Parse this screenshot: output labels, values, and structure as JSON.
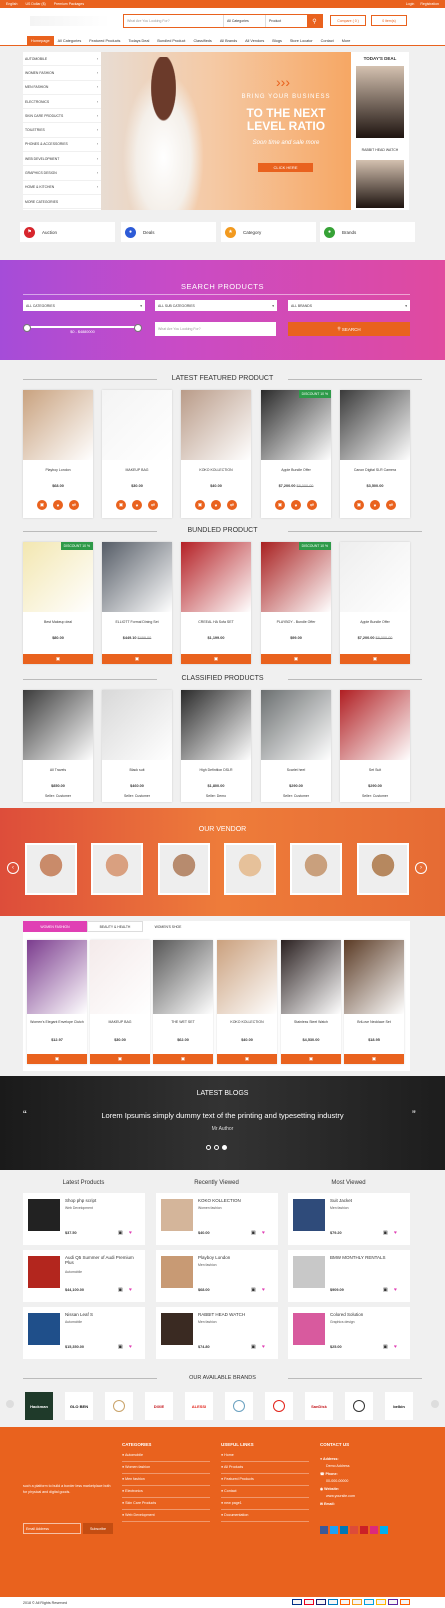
{
  "topbar": {
    "language": "English",
    "currency": "US Dollar ($)",
    "premium": "Premium Packages",
    "login": "Login",
    "register": "Registration"
  },
  "search": {
    "placeholder": "What Are You Looking For?",
    "category": "All Categories",
    "type": "Product"
  },
  "compare": "Compare ( 0 )",
  "cart": "0 item(s)",
  "nav": [
    "Homepage",
    "All Categories",
    "Featured Products",
    "Todays Deal",
    "Bundled Product",
    "Classifieds",
    "All Brands",
    "All Vendors",
    "Blogs",
    "Store Locator",
    "Contact",
    "More"
  ],
  "categories": [
    "AUTOMOBILE",
    "WOMEN FASHION",
    "MEN FASHION",
    "ELECTRONICS",
    "SKIN CARE PRODUCTS",
    "TOILETRIES",
    "PHONES & ACCESSORIES",
    "WEB DEVELOPMENT",
    "GRAPHICS DESIGN",
    "HOME & KITCHEN",
    "MORE CATEGORIES"
  ],
  "hero": {
    "line1": "BRING YOUR BUSINESS",
    "line2": "TO THE NEXT LEVEL RATIO",
    "line3": "Soon time and sale more",
    "cta": "CLICK HERE"
  },
  "todays_deal": {
    "title": "TODAY'S DEAL",
    "item": "RABBIT HEAD WATCH"
  },
  "features": [
    "Auction",
    "Deals",
    "Category",
    "Brands"
  ],
  "search_products": {
    "title": "SEARCH PRODUCTS",
    "cat": "ALL CATEGORIES",
    "subcat": "ALL SUB CATEGORIES",
    "brand": "ALL BRANDS",
    "range": "$0 - $4880000",
    "placeholder": "What Are You Looking For?",
    "button": "SEARCH"
  },
  "featured": {
    "title": "LATEST FEATURED PRODUCT",
    "items": [
      {
        "name": "Playboy London",
        "price": "$68.00",
        "old": ""
      },
      {
        "name": "MAKEUP BAG",
        "price": "$30.00",
        "old": ""
      },
      {
        "name": "KOKO KOLLECTION",
        "price": "$40.00",
        "old": ""
      },
      {
        "name": "Apple Bundle Offer",
        "price": "$7,200.00",
        "old": "$8,000.00",
        "discount": "DISCOUNT 10 %"
      },
      {
        "name": "Canon Digital SLR Camera",
        "price": "$3,500.00",
        "old": ""
      }
    ]
  },
  "bundled": {
    "title": "BUNDLED PRODUCT",
    "items": [
      {
        "name": "Best Makeup deal",
        "price": "$80.00",
        "old": "",
        "discount": "DISCOUNT 10 %"
      },
      {
        "name": "ELLIOTT Formal Dining Set",
        "price": "$449.10",
        "old": "$499.00"
      },
      {
        "name": "CREEAL HA Sofa SET",
        "price": "$1,199.00",
        "old": ""
      },
      {
        "name": "PLAYBOY - Bundle Offer",
        "price": "$99.00",
        "old": "",
        "discount": "DISCOUNT 10 %"
      },
      {
        "name": "Apple Bundle Offer",
        "price": "$7,200.00",
        "old": "$8,000.00"
      }
    ]
  },
  "classified": {
    "title": "CLASSIFIED PRODUCTS",
    "items": [
      {
        "name": "All Travels",
        "price": "$850.00",
        "seller": "Seller: Customer"
      },
      {
        "name": "Black suit",
        "price": "$460.00",
        "seller": "Seller: Customer"
      },
      {
        "name": "High Definition DSLR",
        "price": "$1,800.00",
        "seller": "Seller: Demo"
      },
      {
        "name": "Scarlet heel",
        "price": "$290.00",
        "seller": "Seller: Customer"
      },
      {
        "name": "Set Suit",
        "price": "$290.00",
        "seller": "Seller: Customer"
      }
    ]
  },
  "vendor": {
    "title": "OUR VENDOR"
  },
  "tabs": {
    "labels": [
      "WOMEN FASHION",
      "BEAUTY & HEALTH",
      "WOMEN'S SHOE"
    ],
    "items": [
      {
        "name": "Women's Elegant Envelope Clutch",
        "price": "$12.97"
      },
      {
        "name": "MAKEUP BAG",
        "price": "$30.00"
      },
      {
        "name": "THE WET SET",
        "price": "$62.00"
      },
      {
        "name": "KOKO KOLLECTION",
        "price": "$40.00"
      },
      {
        "name": "Stainless Steel Watch",
        "price": "$4,530.00"
      },
      {
        "name": "BriLove Necklace Set",
        "price": "$18.95"
      }
    ]
  },
  "blogs": {
    "title": "LATEST BLOGS",
    "quote": "Lorem Ipsumis simply dummy text of the printing and typesetting industry",
    "author": "Mr Author"
  },
  "columns": [
    {
      "title": "Latest Products",
      "items": [
        {
          "name": "Shop php script",
          "cat": "Web Development",
          "price": "$37.50"
        },
        {
          "name": "Audi Q5 Summer of Audi Premium Plus",
          "cat": "Automobile",
          "price": "$44,100.00"
        },
        {
          "name": "Nissan Leaf S",
          "cat": "Automobile",
          "price": "$15,350.00"
        }
      ]
    },
    {
      "title": "Recently Viewed",
      "items": [
        {
          "name": "KOKO KOLLECTION",
          "cat": "Women fashion",
          "price": "$40.00"
        },
        {
          "name": "Playboy London",
          "cat": "Men fashion",
          "price": "$68.00"
        },
        {
          "name": "RABBIT HEAD WATCH",
          "cat": "Men fashion",
          "price": "$74.80"
        }
      ]
    },
    {
      "title": "Most Viewed",
      "items": [
        {
          "name": "Suit Jacket",
          "cat": "Men fashion",
          "price": "$79.20"
        },
        {
          "name": "BMW MONTHLY RENTALS",
          "cat": "",
          "price": "$909.09"
        },
        {
          "name": "Colored Solution",
          "cat": "Graphics design",
          "price": "$25.00"
        }
      ]
    }
  ],
  "brands": {
    "title": "OUR AVAILABLE BRANDS",
    "names": [
      "Hackman",
      "GLO BEN",
      "",
      "DIXIE",
      "ALESSI",
      "",
      "",
      "SanDisk",
      "",
      "belkin"
    ]
  },
  "footer": {
    "about": "such a platform to build a border less marketplace both for physical and digital goods.",
    "email_placeholder": "Email Address",
    "subscribe": "Subscribe",
    "categories_title": "CATEGORIES",
    "categories": [
      "Automobile",
      "Women fashion",
      "Men fashion",
      "Electronics",
      "Skin Care Products",
      "Web Development"
    ],
    "links_title": "USEFUL LINKS",
    "links": [
      "Home",
      "All Products",
      "Featured Products",
      "Contact",
      "new page1",
      "Documentation"
    ],
    "contact_title": "CONTACT US",
    "address_label": "Address:",
    "address": "Demo Address",
    "phone_label": "Phone:",
    "phone": "00-000-00000",
    "website_label": "Website:",
    "website": "www.yoursite.com",
    "email_label": "Email:",
    "copyright": "2018 © All Rights Reserved"
  },
  "colors": {
    "accent": "#e9621e",
    "purple": "#c94bc6",
    "green": "#2e9a49"
  }
}
